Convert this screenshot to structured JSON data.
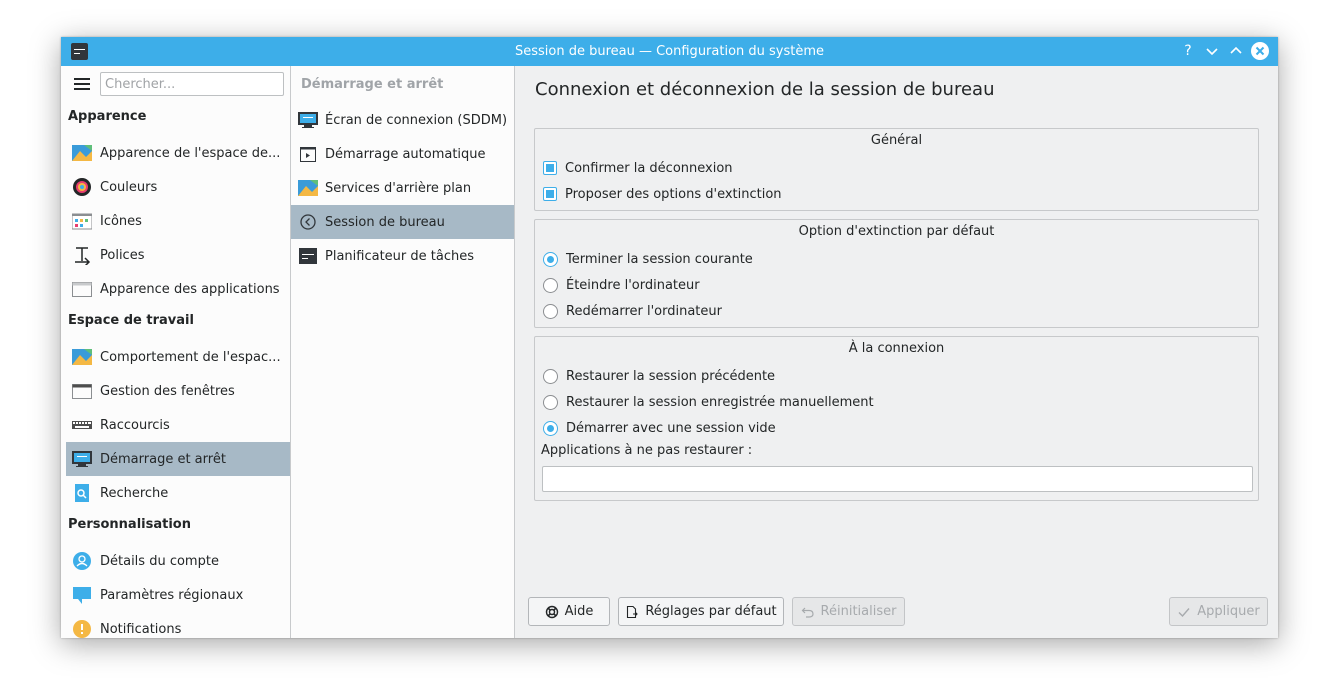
{
  "window": {
    "title": "Session de bureau — Configuration du système",
    "controls": {
      "help": "?",
      "minimize": "⌄",
      "maximize": "⌃",
      "close": "✕"
    }
  },
  "sidebar": {
    "search_placeholder": "Chercher...",
    "sections": {
      "appearance": "Apparence",
      "workspace": "Espace de travail",
      "personalization": "Personnalisation"
    },
    "items": [
      {
        "label": "Apparence de l'espace de...",
        "icon": "workspace-theme-icon"
      },
      {
        "label": "Couleurs",
        "icon": "colors-icon"
      },
      {
        "label": "Icônes",
        "icon": "icons-icon"
      },
      {
        "label": "Polices",
        "icon": "fonts-icon"
      },
      {
        "label": "Apparence des applications",
        "icon": "application-style-icon"
      },
      {
        "label": "Comportement de l'espac...",
        "icon": "workspace-behavior-icon"
      },
      {
        "label": "Gestion des fenêtres",
        "icon": "window-management-icon"
      },
      {
        "label": "Raccourcis",
        "icon": "keyboard-shortcuts-icon"
      },
      {
        "label": "Démarrage et arrêt",
        "icon": "startup-shutdown-icon",
        "selected": true
      },
      {
        "label": "Recherche",
        "icon": "search-config-icon"
      },
      {
        "label": "Détails du compte",
        "icon": "user-account-icon"
      },
      {
        "label": "Paramètres régionaux",
        "icon": "regional-settings-icon"
      },
      {
        "label": "Notifications",
        "icon": "notifications-icon"
      }
    ]
  },
  "midpanel": {
    "title": "Démarrage et arrêt",
    "items": [
      {
        "label": "Écran de connexion (SDDM)",
        "icon": "login-screen-icon"
      },
      {
        "label": "Démarrage automatique",
        "icon": "autostart-icon"
      },
      {
        "label": "Services d'arrière plan",
        "icon": "background-services-icon"
      },
      {
        "label": "Session de bureau",
        "icon": "desktop-session-icon",
        "selected": true
      },
      {
        "label": "Planificateur de tâches",
        "icon": "task-scheduler-icon"
      }
    ]
  },
  "content": {
    "title": "Connexion et déconnexion de la session de bureau",
    "general": {
      "title": "Général",
      "options": [
        {
          "label": "Confirmer la déconnexion",
          "checked": true
        },
        {
          "label": "Proposer des options d'extinction",
          "checked": true
        }
      ]
    },
    "shutdown_default": {
      "title": "Option d'extinction par défaut",
      "options": [
        {
          "label": "Terminer la session courante",
          "checked": true
        },
        {
          "label": "Éteindre l'ordinateur",
          "checked": false
        },
        {
          "label": "Redémarrer l'ordinateur",
          "checked": false
        }
      ]
    },
    "on_login": {
      "title": "À la connexion",
      "options": [
        {
          "label": "Restaurer la session précédente",
          "checked": false
        },
        {
          "label": "Restaurer la session enregistrée manuellement",
          "checked": false
        },
        {
          "label": "Démarrer avec une session vide",
          "checked": true
        }
      ],
      "exclude_label": "Applications à ne pas restaurer :",
      "exclude_value": ""
    }
  },
  "buttons": {
    "help": "Aide",
    "defaults": "Réglages par défaut",
    "reset": "Réinitialiser",
    "apply": "Appliquer"
  },
  "colors": {
    "accent": "#3daee9",
    "selection": "#a7b9c6"
  }
}
